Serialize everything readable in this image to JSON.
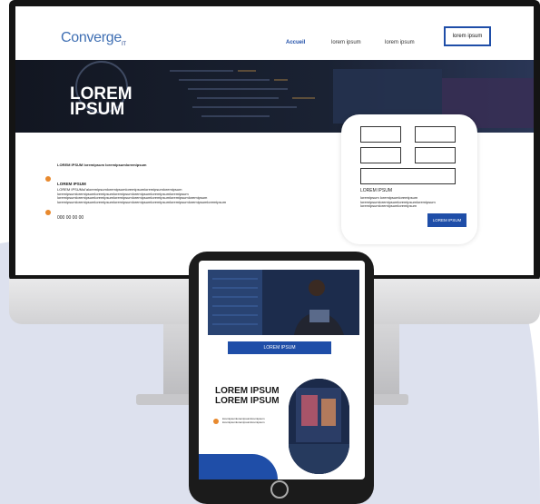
{
  "colors": {
    "accent": "#1f4ea8",
    "orange": "#e8892e",
    "backdrop": "#dde1ee"
  },
  "logo": {
    "text": "Converge",
    "suffix": "IT"
  },
  "nav": {
    "home": "Accueil",
    "link2": "lorem ipsum",
    "link3": "lorem ipsum",
    "button": "lorem ipsum"
  },
  "banner": {
    "title": "LOREM IPSUM"
  },
  "content": {
    "intro": "LOREM IPSUM loremipsum loremipsumloremipsum",
    "item1_title": "LOREM IPSUM",
    "item1_text": "LOREM IPSUMul'aloremipsumloremipsumloremipsumloremipsumloremipsum loremipsumloremipsumloremipsumloremipsumloremipsumloremipsumloremipsum loremipsumloremipsumloremipsumloremipsumloremipsumloremipsumloremipsumloremipsum loremipsumloremipsumloremipsumloremipsumloremipsumloremipsumloremipsumloremipsumloremipsum",
    "phone": "000 00 00 00"
  },
  "form": {
    "label": "LOREM IPSUM",
    "text": "loremipsum loremipsumloremipsum loremipsumloremipsumloremipsumloremipsum loremipsumloremipsumloremipsum",
    "submit": "LOREM IPSUM"
  },
  "tablet": {
    "cta": "LOREM IPSUM",
    "heading": "LOREM IPSUM LOREM IPSUM",
    "lines": "loremipsumloremipsumloremipsum loremipsumloremipsumloremipsum"
  }
}
